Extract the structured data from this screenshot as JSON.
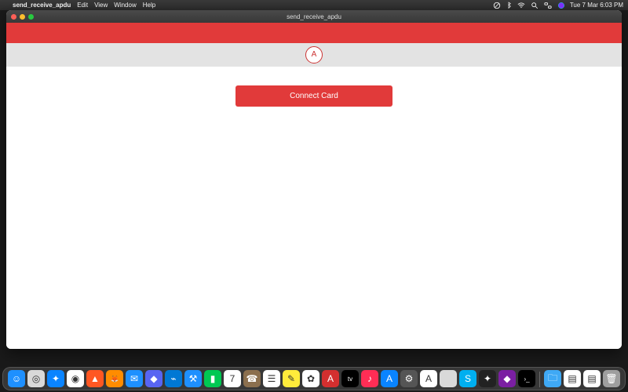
{
  "menubar": {
    "app_name": "send_receive_apdu",
    "menus": [
      "Edit",
      "View",
      "Window",
      "Help"
    ],
    "clock": "Tue 7 Mar  6:03 PM"
  },
  "window": {
    "title": "send_receive_apdu"
  },
  "app": {
    "logo_text": "A",
    "connect_label": "Connect Card"
  },
  "colors": {
    "brand_red": "#e13a3a",
    "band_grey": "#e3e3e3"
  },
  "dock": {
    "items": [
      {
        "name": "finder-icon",
        "color": "#1e90ff",
        "glyph": "☺"
      },
      {
        "name": "launchpad-icon",
        "color": "#d9d9d9",
        "glyph": "◎"
      },
      {
        "name": "safari-icon",
        "color": "#0a84ff",
        "glyph": "✦"
      },
      {
        "name": "chrome-icon",
        "color": "#ffffff",
        "glyph": "◉"
      },
      {
        "name": "brave-icon",
        "color": "#ff5722",
        "glyph": "▲"
      },
      {
        "name": "firefox-icon",
        "color": "#ff8c00",
        "glyph": "🦊"
      },
      {
        "name": "mail-icon",
        "color": "#1e90ff",
        "glyph": "✉"
      },
      {
        "name": "discord-icon",
        "color": "#5865f2",
        "glyph": "◆"
      },
      {
        "name": "vscode-icon",
        "color": "#0078d4",
        "glyph": "⌁"
      },
      {
        "name": "xcode-icon",
        "color": "#1e90ff",
        "glyph": "⚒"
      },
      {
        "name": "facetime-icon",
        "color": "#00c853",
        "glyph": "▮"
      },
      {
        "name": "calendar-icon",
        "color": "#ffffff",
        "glyph": "7"
      },
      {
        "name": "contacts-icon",
        "color": "#8b6f4e",
        "glyph": "☎"
      },
      {
        "name": "reminders-icon",
        "color": "#ffffff",
        "glyph": "☰"
      },
      {
        "name": "notes-icon",
        "color": "#ffeb3b",
        "glyph": "✎"
      },
      {
        "name": "photos-icon",
        "color": "#ffffff",
        "glyph": "✿"
      },
      {
        "name": "adobe-icon",
        "color": "#d32f2f",
        "glyph": "A"
      },
      {
        "name": "appletv-icon",
        "color": "#000000",
        "glyph": "tv"
      },
      {
        "name": "music-icon",
        "color": "#ff2d55",
        "glyph": "♪"
      },
      {
        "name": "appstore-icon",
        "color": "#0a84ff",
        "glyph": "A"
      },
      {
        "name": "settings-icon",
        "color": "#555555",
        "glyph": "⚙"
      },
      {
        "name": "apdu-app-icon",
        "color": "#ffffff",
        "glyph": "A"
      },
      {
        "name": "blank-icon",
        "color": "#d9d9d9",
        "glyph": ""
      },
      {
        "name": "skype-icon",
        "color": "#00aff0",
        "glyph": "S"
      },
      {
        "name": "claw-icon",
        "color": "#222222",
        "glyph": "✦"
      },
      {
        "name": "misc-icon",
        "color": "#7b1fa2",
        "glyph": "◆"
      },
      {
        "name": "terminal-icon",
        "color": "#000000",
        "glyph": "›_"
      }
    ],
    "tray": [
      {
        "name": "folder-icon",
        "color": "#3fa9f5",
        "glyph": "🗀"
      },
      {
        "name": "doc1-icon",
        "color": "#ffffff",
        "glyph": "▤"
      },
      {
        "name": "doc2-icon",
        "color": "#ffffff",
        "glyph": "▤"
      },
      {
        "name": "trash-icon",
        "color": "#9e9e9e",
        "glyph": "🗑"
      }
    ]
  }
}
